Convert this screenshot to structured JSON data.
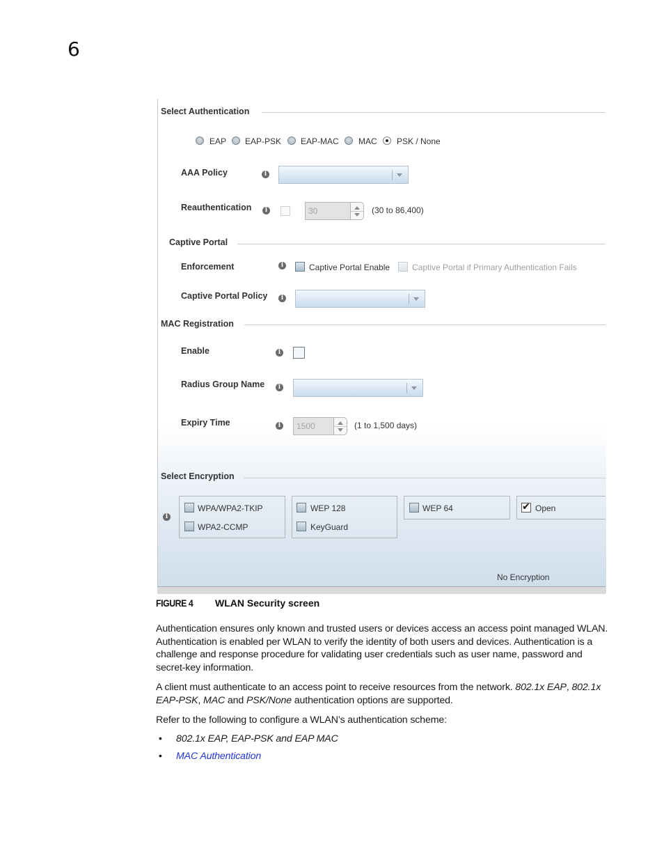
{
  "page": {
    "chapter_number": "6"
  },
  "screen": {
    "select_authentication": {
      "title": "Select Authentication",
      "options": [
        {
          "label": "EAP",
          "selected": false
        },
        {
          "label": "EAP-PSK",
          "selected": false
        },
        {
          "label": "EAP-MAC",
          "selected": false
        },
        {
          "label": "MAC",
          "selected": false
        },
        {
          "label": "PSK / None",
          "selected": true
        }
      ],
      "aaa_policy": {
        "label": "AAA Policy",
        "value": ""
      },
      "reauthentication": {
        "label": "Reauthentication",
        "enabled": false,
        "value": "30",
        "range": "(30 to 86,400)"
      }
    },
    "captive_portal": {
      "title": "Captive Portal",
      "enforcement": {
        "label": "Enforcement",
        "enable_label": "Captive Portal Enable",
        "enable_checked": false,
        "fallback_label": "Captive Portal if Primary Authentication Fails",
        "fallback_checked": false
      },
      "policy": {
        "label": "Captive Portal Policy",
        "value": ""
      }
    },
    "mac_registration": {
      "title": "MAC Registration",
      "enable": {
        "label": "Enable",
        "checked": false
      },
      "radius_group": {
        "label": "Radius Group Name",
        "value": ""
      },
      "expiry": {
        "label": "Expiry Time",
        "value": "1500",
        "range": "(1 to 1,500 days)"
      }
    },
    "select_encryption": {
      "title": "Select Encryption",
      "options": [
        {
          "label": "WPA/WPA2-TKIP",
          "checked": false
        },
        {
          "label": "WPA2-CCMP",
          "checked": false
        },
        {
          "label": "WEP 128",
          "checked": false
        },
        {
          "label": "KeyGuard",
          "checked": false
        },
        {
          "label": "WEP 64",
          "checked": false
        },
        {
          "label": "Open",
          "checked": true
        }
      ],
      "status": "No Encryption"
    }
  },
  "figure": {
    "number": "FIGURE 4",
    "caption": "WLAN Security screen"
  },
  "body": {
    "para1": "Authentication ensures only known and trusted users or devices access an access point managed WLAN. Authentication is enabled per WLAN to verify the identity of both users and devices. Authentication is a challenge and response procedure for validating user credentials such as user name, password and secret-key information.",
    "para2_start": "A client must authenticate to an access point to receive resources from the network. ",
    "para2_em1": "802.1x EAP",
    "para2_sep1": ", ",
    "para2_em2": "802.1x EAP-PSK",
    "para2_sep2": ", ",
    "para2_em3": "MAC",
    "para2_sep3": " and ",
    "para2_em4": "PSK/None",
    "para2_end": " authentication options are supported.",
    "para3": "Refer to the following to configure a WLAN’s authentication scheme:",
    "bullets": [
      {
        "text": "802.1x EAP, EAP-PSK and EAP MAC",
        "is_link": false
      },
      {
        "text": "MAC Authentication",
        "is_link": true
      }
    ],
    "bullet_glyph": "•",
    "link_color": "#2233dd"
  }
}
